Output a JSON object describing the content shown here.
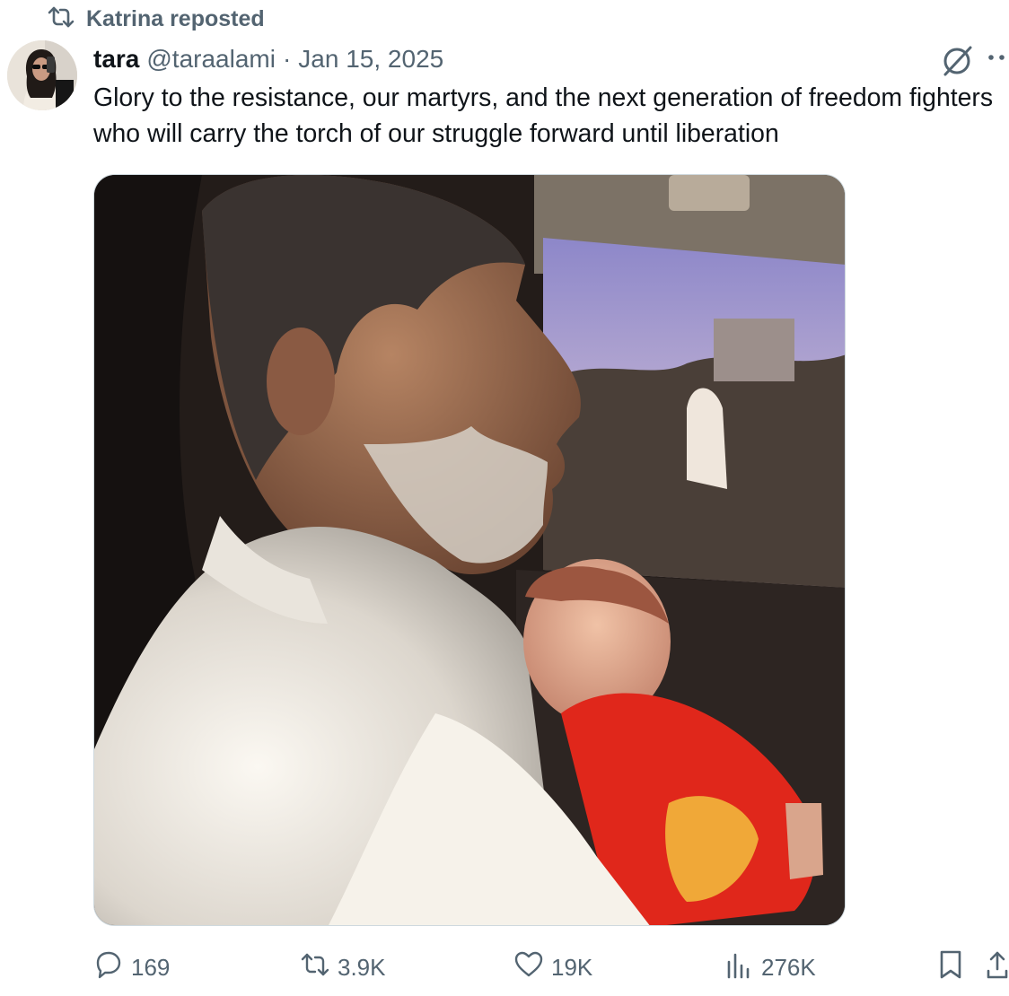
{
  "repost_banner": {
    "icon": "repost-icon",
    "text": "Katrina reposted"
  },
  "tweet": {
    "author_name": "tara",
    "author_handle": "@taraalami",
    "separator": "·",
    "date": "Jan 15, 2025",
    "text": "Glory to the resistance, our martyrs, and the next generation of freedom fighters who will carry the torch of our struggle forward until liberation",
    "media": {
      "kind": "photo",
      "icon": "photo"
    }
  },
  "actions": {
    "replies": {
      "icon": "reply-icon",
      "count": "169"
    },
    "reposts": {
      "icon": "repost-icon",
      "count": "3.9K"
    },
    "likes": {
      "icon": "heart-icon",
      "count": "19K"
    },
    "views": {
      "icon": "views-icon",
      "count": "276K"
    },
    "bookmark": {
      "icon": "bookmark-icon"
    },
    "share": {
      "icon": "share-icon"
    }
  },
  "colors": {
    "text": "#0f1419",
    "muted": "#536471",
    "border": "#cfd9de"
  }
}
